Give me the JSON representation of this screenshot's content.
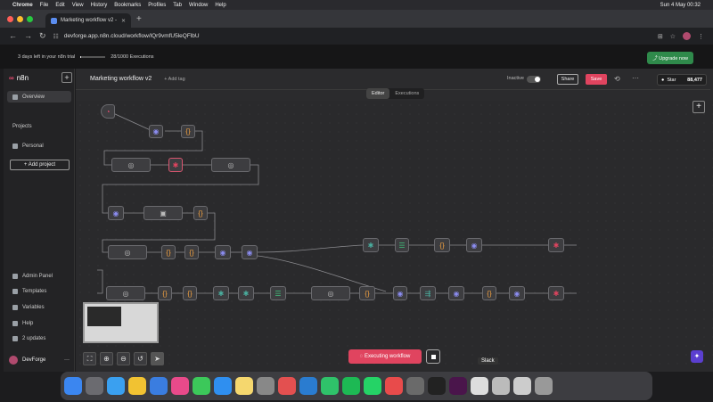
{
  "menubar": {
    "app": "Chrome",
    "items": [
      "File",
      "Edit",
      "View",
      "History",
      "Bookmarks",
      "Profiles",
      "Tab",
      "Window",
      "Help"
    ],
    "clock": "Sun 4 May  00:32"
  },
  "browser": {
    "tab_title": "Marketing workflow v2 -",
    "url": "devforge.app.n8n.cloud/workflow/lQr9vmfU5leQFlbU"
  },
  "trial": {
    "days_left": "3 days left in your n8n trial",
    "executions": "28/1000 Executions",
    "executions_used_fraction": 0.028,
    "upgrade_label": "Upgrade now"
  },
  "sidebar": {
    "logo": "n8n",
    "overview": "Overview",
    "projects_heading": "Projects",
    "personal": "Personal",
    "add_project": "+ Add project",
    "bottom": [
      "Admin Panel",
      "Templates",
      "Variables",
      "Help",
      "2 updates"
    ],
    "user": "DevForge"
  },
  "header": {
    "workflow_title": "Marketing workflow v2",
    "add_tag": "+ Add tag",
    "inactive": "Inactive",
    "share": "Share",
    "save": "Save",
    "star_label": "Star",
    "star_count": "88,477"
  },
  "editor_tabs": [
    "Editor",
    "Executions"
  ],
  "canvas": {
    "execute": "Executing workflow",
    "tooltip": "Slack"
  },
  "colors": {
    "accent": "#e0445f",
    "upgrade": "#2f8a4b",
    "node_border": "#6a6a6e"
  },
  "icons": [
    "apple-icon",
    "search-icon",
    "gear-icon",
    "plus-icon",
    "zoom-in-icon",
    "zoom-out-icon",
    "undo-icon",
    "pointer-icon",
    "stop-icon",
    "sparkle-icon"
  ]
}
